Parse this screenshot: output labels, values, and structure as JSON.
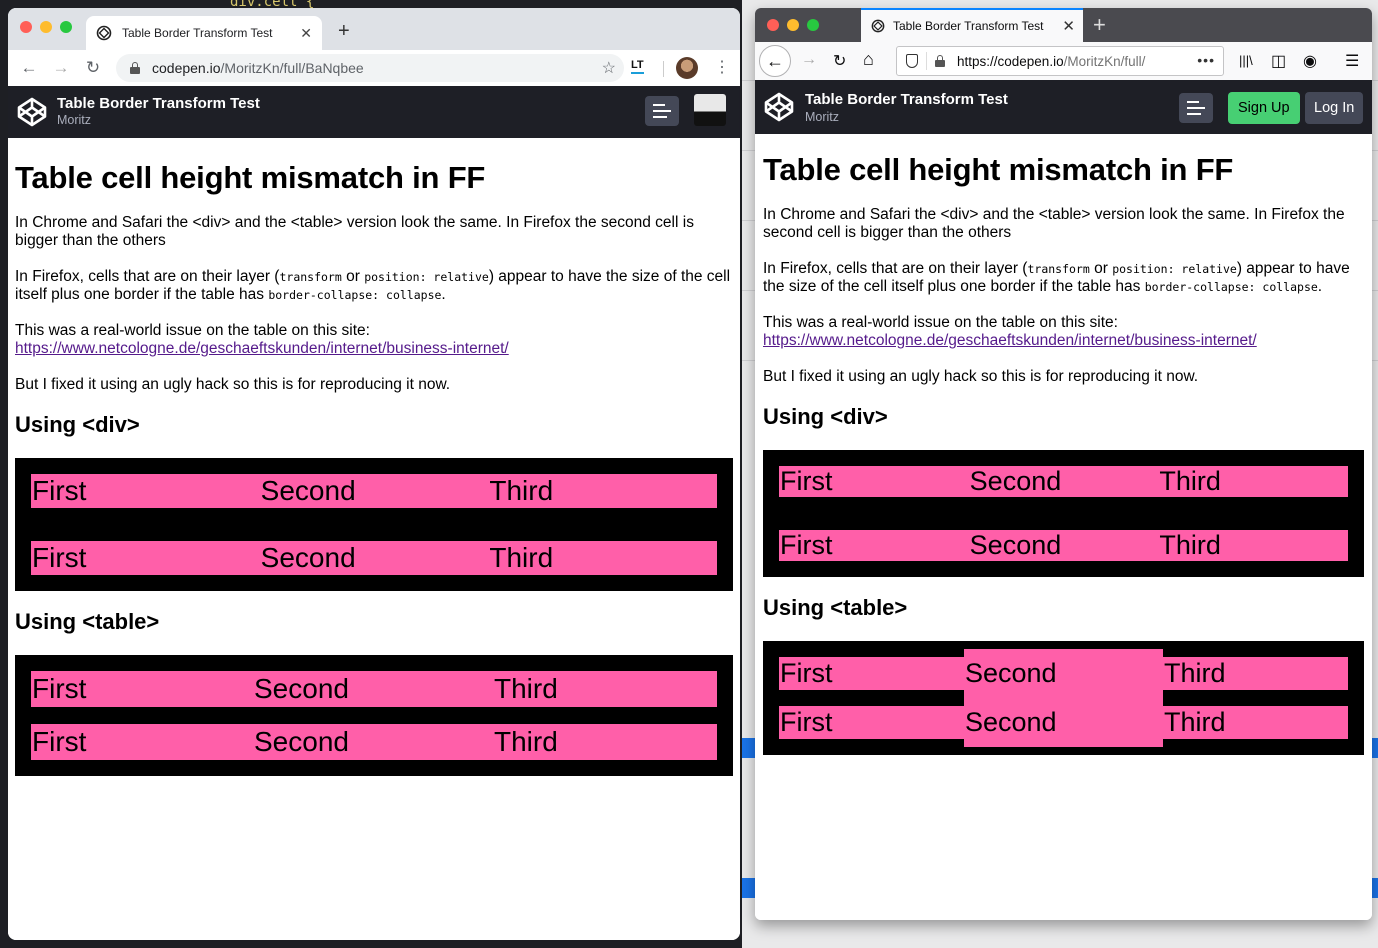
{
  "background": {
    "code_snippet": "div.cell {"
  },
  "chrome": {
    "tab": {
      "title": "Table Border Transform Test",
      "close_glyph": "✕"
    },
    "newtab_glyph": "+",
    "toolbar": {
      "back_glyph": "←",
      "forward_glyph": "→",
      "reload_glyph": "↻",
      "url_host": "codepen.io",
      "url_path": "/MoritzKn/full/BaNqbee",
      "star_glyph": "☆",
      "extension_label": "LT",
      "menu_glyph": "⋮"
    }
  },
  "firefox": {
    "tab": {
      "title": "Table Border Transform Test",
      "close_glyph": "✕"
    },
    "newtab_glyph": "+",
    "toolbar": {
      "back_glyph": "←",
      "forward_glyph": "→",
      "reload_glyph": "↻",
      "home_glyph": "⌂",
      "url_host": "https://codepen.io",
      "url_path": "/MoritzKn/full/",
      "page_actions_glyph": "•••",
      "library_glyph": "|||\\",
      "sidebar_glyph": "◫",
      "account_glyph": "◉",
      "menu_glyph": "☰"
    }
  },
  "codepen": {
    "pen_title": "Table Border Transform Test",
    "author": "Moritz",
    "signup_label": "Sign Up",
    "login_label": "Log In",
    "colors": {
      "header_bg": "#1e1f26",
      "signup_green": "#47cf73",
      "button_gray": "#444857"
    }
  },
  "page": {
    "heading": "Table cell height mismatch in FF",
    "para1": "In Chrome and Safari the <div> and the <table> version look the same. In Firefox the second cell is bigger than the others",
    "para2_start": "In Firefox, cells that are on their layer (",
    "para2_code1": "transform",
    "para2_or": " or ",
    "para2_code2": "position: relative",
    "para2_mid": ") appear to have the size of the cell itself plus one border if the table has ",
    "para2_code3": "border-collapse: collapse",
    "para2_end": ".",
    "para3": "This was a real-world issue on the table on this site:",
    "link": "https://www.netcologne.de/geschaeftskunden/internet/business-internet/",
    "para4": "But I fixed it using an ugly hack so this is for reproducing it now.",
    "div_heading": "Using <div>",
    "table_heading": "Using <table>",
    "rows": [
      [
        "First",
        "Second",
        "Third"
      ],
      [
        "First",
        "Second",
        "Third"
      ]
    ],
    "colors": {
      "cell_pink": "#ff5fa9",
      "border_black": "#000000",
      "link_purple": "#551a8b"
    }
  }
}
